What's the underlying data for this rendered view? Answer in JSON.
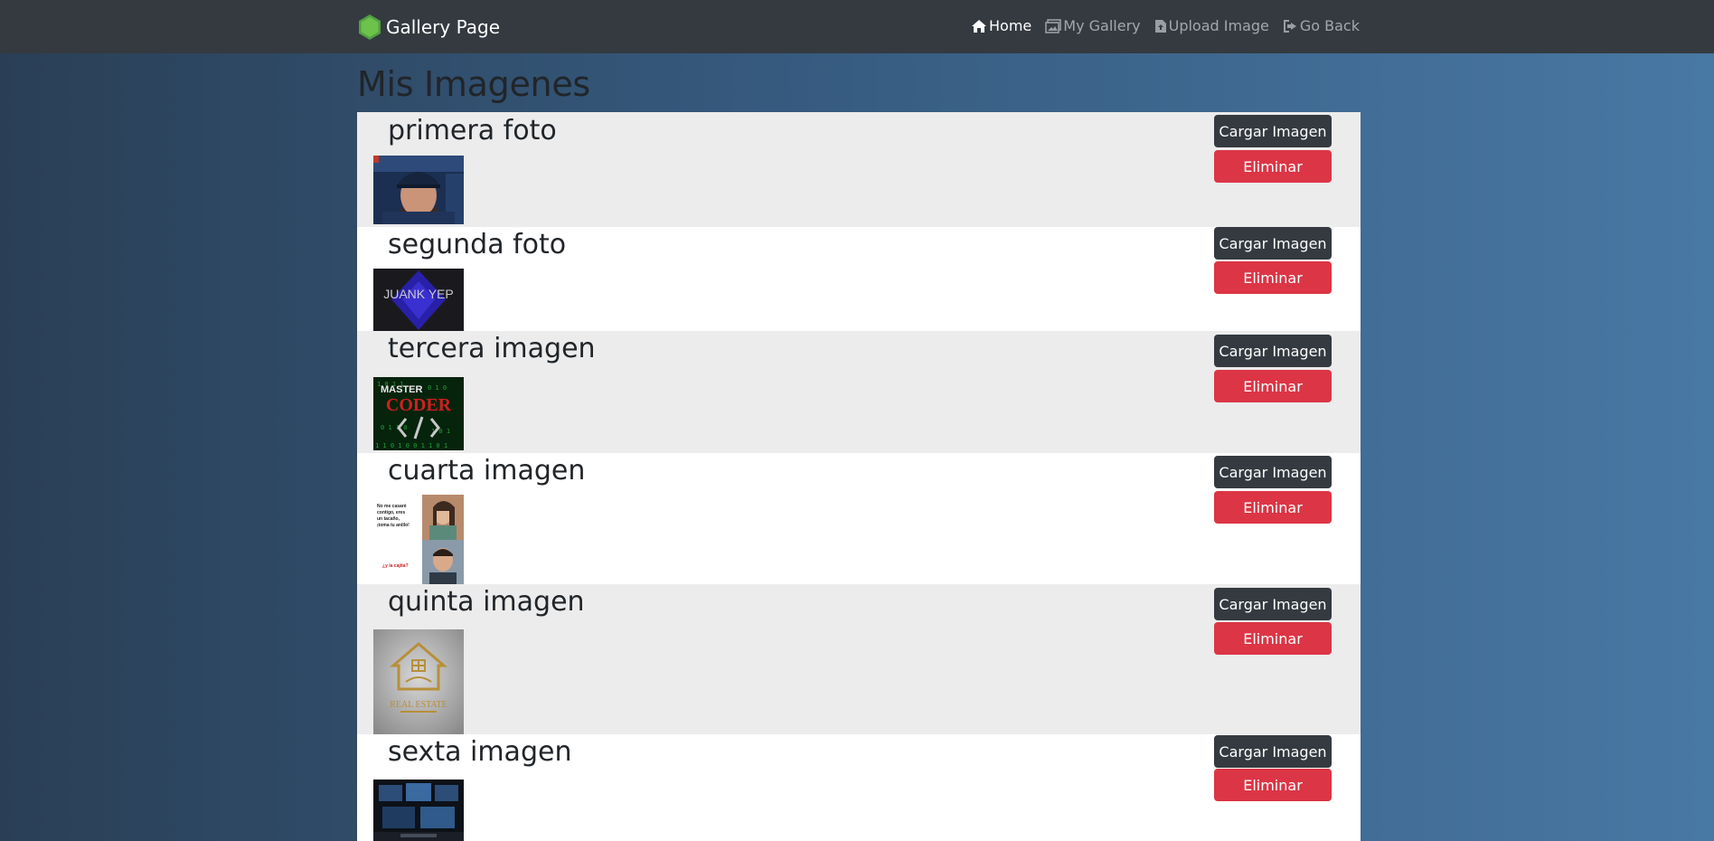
{
  "navbar": {
    "brand_title": "Gallery Page",
    "brand_logo_text": "node",
    "links": [
      {
        "label": "Home",
        "icon": "home-icon"
      },
      {
        "label": "My Gallery",
        "icon": "images-icon"
      },
      {
        "label": "Upload Image",
        "icon": "file-upload-icon"
      },
      {
        "label": "Go Back",
        "icon": "sign-out-icon"
      }
    ]
  },
  "page_title": "Mis Imagenes",
  "gallery": {
    "upload_label": "Cargar Imagen",
    "delete_label": "Eliminar",
    "items": [
      {
        "title": "primera foto",
        "thumb_text": ""
      },
      {
        "title": "segunda foto",
        "thumb_text": "JUANK YEP"
      },
      {
        "title": "tercera imagen",
        "thumb_text": "MASTER CODER"
      },
      {
        "title": "cuarta imagen",
        "thumb_text": "No me casaré contigo, eres un tacaño, ¡toma tu anillo!"
      },
      {
        "title": "quinta imagen",
        "thumb_text": "REAL ESTATE"
      },
      {
        "title": "sexta imagen",
        "thumb_text": ""
      }
    ]
  },
  "colors": {
    "navbar": "#343a40",
    "danger": "#dc3545",
    "dark_button": "#343a40",
    "row_shade": "#ececec"
  }
}
